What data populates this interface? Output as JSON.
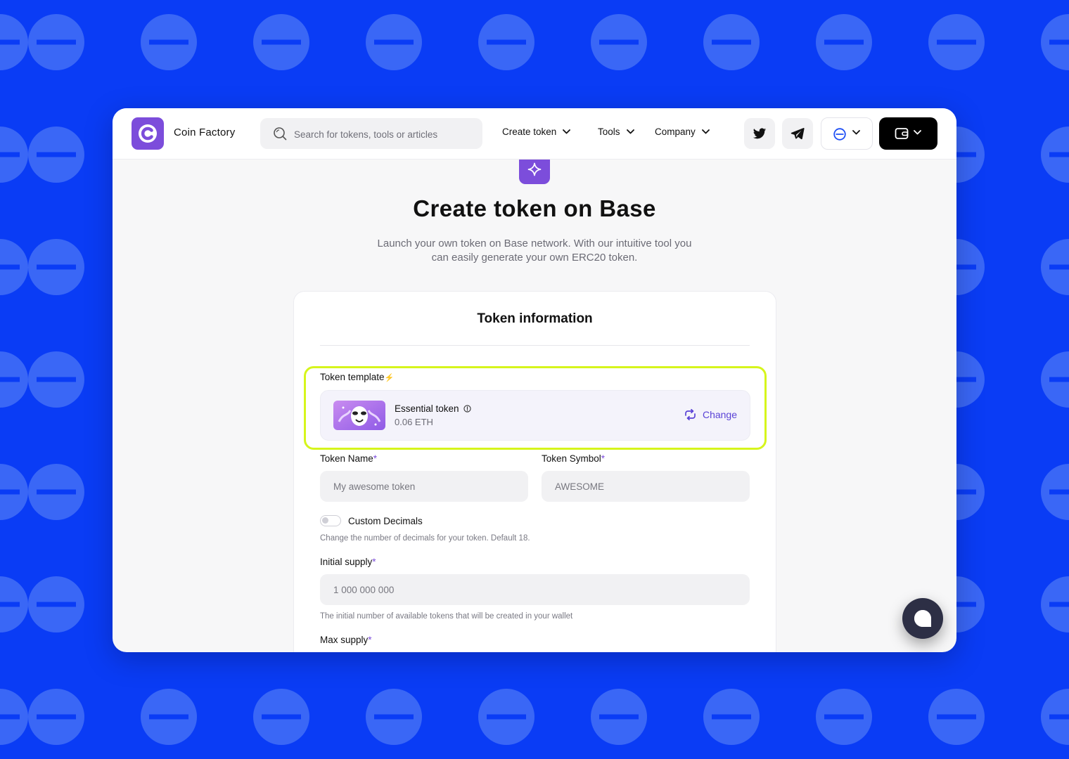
{
  "header": {
    "brand": "Coin Factory",
    "search_placeholder": "Search for tokens, tools or articles",
    "nav": [
      {
        "label": "Create token"
      },
      {
        "label": "Tools"
      },
      {
        "label": "Company"
      }
    ]
  },
  "hero": {
    "title": "Create token on Base",
    "subtitle": "Launch your own token on Base network. With our intuitive tool you can easily generate your own ERC20 token."
  },
  "form": {
    "section_title": "Token information",
    "template": {
      "label": "Token template",
      "name": "Essential token",
      "price": "0.06 ETH",
      "change_label": "Change"
    },
    "token_name": {
      "label": "Token Name",
      "placeholder": "My awesome token"
    },
    "token_symbol": {
      "label": "Token Symbol",
      "placeholder": "AWESOME"
    },
    "custom_decimals": {
      "label": "Custom Decimals",
      "help": "Change the number of decimals for your token. Default 18.",
      "enabled": false
    },
    "initial_supply": {
      "label": "Initial supply",
      "placeholder": "1 000 000 000",
      "help": "The initial number of available tokens that will be created in your wallet"
    },
    "max_supply": {
      "label": "Max supply"
    },
    "required_mark": "*",
    "bolt_mark": "⚡"
  },
  "colors": {
    "page_background": "#0a3cf5",
    "pattern_circle": "#3a67f6",
    "brand_purple": "#7c4ddb",
    "highlight": "#d6f51c",
    "link": "#5a43d6"
  },
  "icons": {
    "logo": "coin-factory-logo-icon",
    "search": "search-icon",
    "twitter": "twitter-icon",
    "telegram": "telegram-icon",
    "network": "base-network-icon",
    "wallet": "wallet-icon",
    "hero": "sparkle-icon",
    "info": "info-icon",
    "change": "refresh-icon",
    "chat": "chat-icon"
  }
}
